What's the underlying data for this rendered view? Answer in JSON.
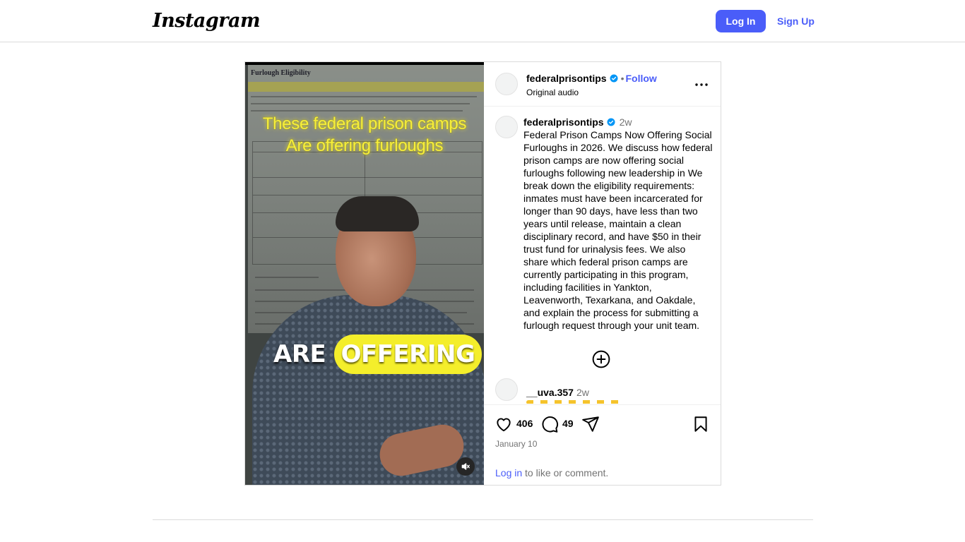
{
  "header": {
    "logo": "Instagram",
    "login_label": "Log In",
    "signup_label": "Sign Up"
  },
  "media": {
    "doc_heading": "Furlough Eligibility",
    "caption_top_line1": "These federal prison camps",
    "caption_top_line2": "Are offering furloughs",
    "caption_big_part1": "ARE",
    "caption_big_part2": "OFFERING",
    "mute_icon": "speaker-muted-icon"
  },
  "post": {
    "username": "federalprisontips",
    "follow_label": "Follow",
    "audio": "Original audio",
    "caption": {
      "username": "federalprisontips",
      "time": "2w",
      "text": "Federal Prison Camps Now Offering Social Furloughs in 2026.  We discuss how federal prison camps are now offering social furloughs following new leadership in We break down the eligibility requirements: inmates must have been incarcerated for longer than 90 days, have less than two years until release, maintain a clean disciplinary record, and have $50 in their trust fund for urinalysis fees. We also share which federal prison camps are currently participating in this program, including facilities in Yankton, Leavenworth, Texarkana, and Oakdale, and explain the process for submitting a furlough request through your unit team."
    },
    "comment": {
      "username": "__uva.357",
      "time": "2w"
    },
    "likes": "406",
    "comments_count": "49",
    "date": "January 10",
    "login_prompt_link": "Log in",
    "login_prompt_rest": " to like or comment."
  },
  "colors": {
    "brand_blue": "#4a5df9",
    "verified_blue": "#0095f6",
    "caption_yellow": "#f7ef3a"
  }
}
